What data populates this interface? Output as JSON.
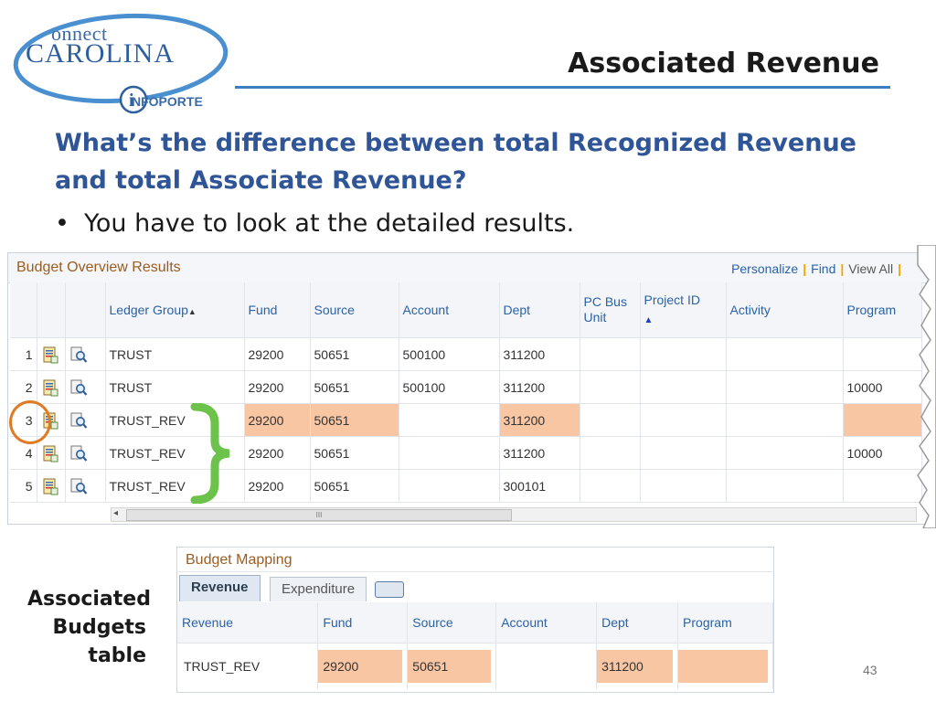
{
  "logo": {
    "word_top": "onnect",
    "word_initial": "C",
    "word_main": "AROLINA",
    "word_sub": "NFOPORTE"
  },
  "slide": {
    "title": "Associated Revenue",
    "question": "What’s the difference between total Recognized Revenue and total Associate Revenue?",
    "bullet": "You have to look at the detailed results.",
    "page_number": "43"
  },
  "overview": {
    "panel_title": "Budget Overview Results",
    "links": {
      "personalize": "Personalize",
      "find": "Find",
      "view_all": "View All"
    },
    "columns": [
      "Ledger Group",
      "Fund",
      "Source",
      "Account",
      "Dept",
      "PC Bus Unit",
      "Project ID",
      "Activity",
      "Program"
    ],
    "rows": [
      {
        "num": "1",
        "ledger": "TRUST",
        "fund": "29200",
        "source": "50651",
        "account": "500100",
        "dept": "311200",
        "pcbu": "",
        "project": "",
        "activity": "",
        "program": ""
      },
      {
        "num": "2",
        "ledger": "TRUST",
        "fund": "29200",
        "source": "50651",
        "account": "500100",
        "dept": "311200",
        "pcbu": "",
        "project": "",
        "activity": "",
        "program": "10000"
      },
      {
        "num": "3",
        "ledger": "TRUST_REV",
        "fund": "29200",
        "source": "50651",
        "account": "",
        "dept": "311200",
        "pcbu": "",
        "project": "",
        "activity": "",
        "program": ""
      },
      {
        "num": "4",
        "ledger": "TRUST_REV",
        "fund": "29200",
        "source": "50651",
        "account": "",
        "dept": "311200",
        "pcbu": "",
        "project": "",
        "activity": "",
        "program": "10000"
      },
      {
        "num": "5",
        "ledger": "TRUST_REV",
        "fund": "29200",
        "source": "50651",
        "account": "",
        "dept": "300101",
        "pcbu": "",
        "project": "",
        "activity": "",
        "program": ""
      }
    ],
    "scroll_thumb_glyph": "III",
    "highlight_color": "#f9c6a3",
    "circle_color": "#e07b23",
    "brace_color": "#6cc24a"
  },
  "mapping": {
    "side_label": [
      "Associated",
      "Budgets",
      "table"
    ],
    "panel_title": "Budget Mapping",
    "tabs": [
      "Revenue",
      "Expenditure"
    ],
    "columns": [
      "Revenue",
      "Fund",
      "Source",
      "Account",
      "Dept",
      "Program"
    ],
    "row": {
      "revenue": "TRUST_REV",
      "fund": "29200",
      "source": "50651",
      "account": "",
      "dept": "311200",
      "program": ""
    }
  }
}
